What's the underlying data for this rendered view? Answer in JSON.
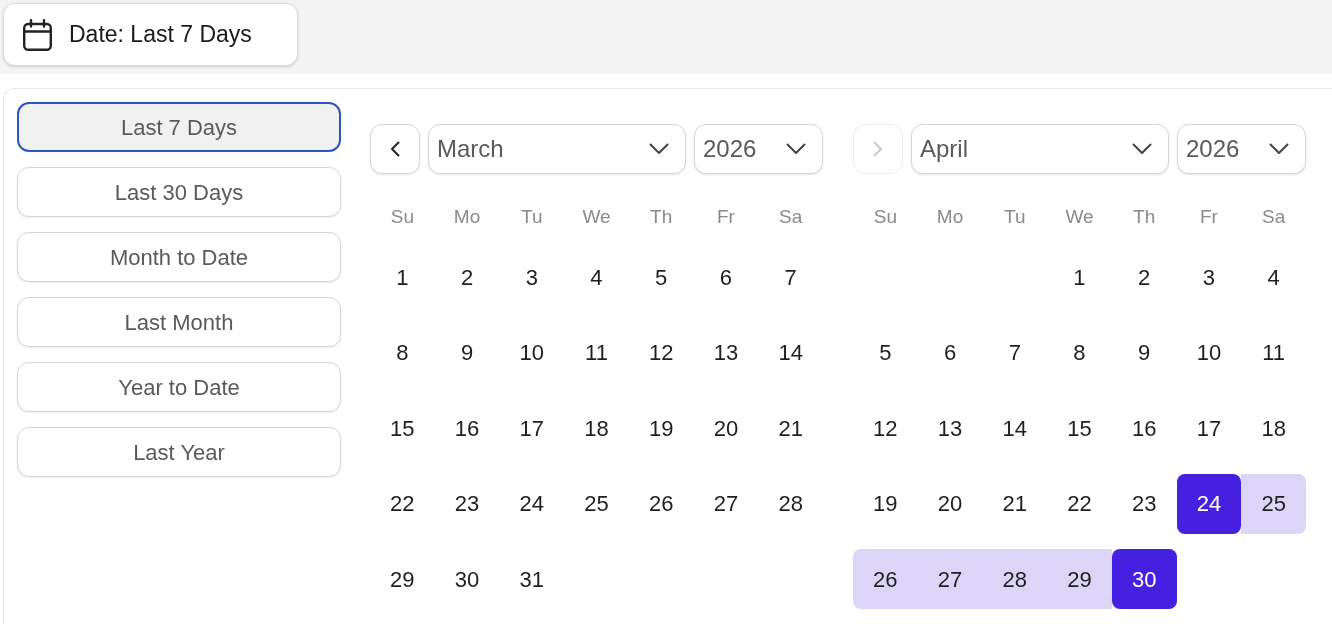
{
  "date_button": {
    "label": "Date: Last 7 Days"
  },
  "presets": [
    {
      "label": "Last 7 Days",
      "selected": true
    },
    {
      "label": "Last 30 Days",
      "selected": false
    },
    {
      "label": "Month to Date",
      "selected": false
    },
    {
      "label": "Last Month",
      "selected": false
    },
    {
      "label": "Year to Date",
      "selected": false
    },
    {
      "label": "Last Year",
      "selected": false
    }
  ],
  "calendars": [
    {
      "nav_button": {
        "kind": "prev",
        "disabled": false
      },
      "month": "March",
      "year": "2026",
      "weekdays": [
        "Su",
        "Mo",
        "Tu",
        "We",
        "Th",
        "Fr",
        "Sa"
      ],
      "weeks": [
        [
          {
            "kind": "day",
            "day": "1",
            "selected": false,
            "in_range": false
          },
          {
            "kind": "day",
            "day": "2",
            "selected": false,
            "in_range": false
          },
          {
            "kind": "day",
            "day": "3",
            "selected": false,
            "in_range": false
          },
          {
            "kind": "day",
            "day": "4",
            "selected": false,
            "in_range": false
          },
          {
            "kind": "day",
            "day": "5",
            "selected": false,
            "in_range": false
          },
          {
            "kind": "day",
            "day": "6",
            "selected": false,
            "in_range": false
          },
          {
            "kind": "day",
            "day": "7",
            "selected": false,
            "in_range": false
          }
        ],
        [
          {
            "kind": "day",
            "day": "8",
            "selected": false,
            "in_range": false
          },
          {
            "kind": "day",
            "day": "9",
            "selected": false,
            "in_range": false
          },
          {
            "kind": "day",
            "day": "10",
            "selected": false,
            "in_range": false
          },
          {
            "kind": "day",
            "day": "11",
            "selected": false,
            "in_range": false
          },
          {
            "kind": "day",
            "day": "12",
            "selected": false,
            "in_range": false
          },
          {
            "kind": "day",
            "day": "13",
            "selected": false,
            "in_range": false
          },
          {
            "kind": "day",
            "day": "14",
            "selected": false,
            "in_range": false
          }
        ],
        [
          {
            "kind": "day",
            "day": "15",
            "selected": false,
            "in_range": false
          },
          {
            "kind": "day",
            "day": "16",
            "selected": false,
            "in_range": false
          },
          {
            "kind": "day",
            "day": "17",
            "selected": false,
            "in_range": false
          },
          {
            "kind": "day",
            "day": "18",
            "selected": false,
            "in_range": false
          },
          {
            "kind": "day",
            "day": "19",
            "selected": false,
            "in_range": false
          },
          {
            "kind": "day",
            "day": "20",
            "selected": false,
            "in_range": false
          },
          {
            "kind": "day",
            "day": "21",
            "selected": false,
            "in_range": false
          }
        ],
        [
          {
            "kind": "day",
            "day": "22",
            "selected": false,
            "in_range": false
          },
          {
            "kind": "day",
            "day": "23",
            "selected": false,
            "in_range": false
          },
          {
            "kind": "day",
            "day": "24",
            "selected": false,
            "in_range": false
          },
          {
            "kind": "day",
            "day": "25",
            "selected": false,
            "in_range": false
          },
          {
            "kind": "day",
            "day": "26",
            "selected": false,
            "in_range": false
          },
          {
            "kind": "day",
            "day": "27",
            "selected": false,
            "in_range": false
          },
          {
            "kind": "day",
            "day": "28",
            "selected": false,
            "in_range": false
          }
        ],
        [
          {
            "kind": "day",
            "day": "29",
            "selected": false,
            "in_range": false
          },
          {
            "kind": "day",
            "day": "30",
            "selected": false,
            "in_range": false
          },
          {
            "kind": "day",
            "day": "31",
            "selected": false,
            "in_range": false
          }
        ]
      ]
    },
    {
      "nav_button": {
        "kind": "next",
        "disabled": true
      },
      "month": "April",
      "year": "2026",
      "weekdays": [
        "Su",
        "Mo",
        "Tu",
        "We",
        "Th",
        "Fr",
        "Sa"
      ],
      "weeks": [
        [
          {
            "kind": "blank"
          },
          {
            "kind": "blank"
          },
          {
            "kind": "blank"
          },
          {
            "kind": "day",
            "day": "1",
            "selected": false,
            "in_range": false
          },
          {
            "kind": "day",
            "day": "2",
            "selected": false,
            "in_range": false
          },
          {
            "kind": "day",
            "day": "3",
            "selected": false,
            "in_range": false
          },
          {
            "kind": "day",
            "day": "4",
            "selected": false,
            "in_range": false
          }
        ],
        [
          {
            "kind": "day",
            "day": "5",
            "selected": false,
            "in_range": false
          },
          {
            "kind": "day",
            "day": "6",
            "selected": false,
            "in_range": false
          },
          {
            "kind": "day",
            "day": "7",
            "selected": false,
            "in_range": false
          },
          {
            "kind": "day",
            "day": "8",
            "selected": false,
            "in_range": false
          },
          {
            "kind": "day",
            "day": "9",
            "selected": false,
            "in_range": false
          },
          {
            "kind": "day",
            "day": "10",
            "selected": false,
            "in_range": false
          },
          {
            "kind": "day",
            "day": "11",
            "selected": false,
            "in_range": false
          }
        ],
        [
          {
            "kind": "day",
            "day": "12",
            "selected": false,
            "in_range": false
          },
          {
            "kind": "day",
            "day": "13",
            "selected": false,
            "in_range": false
          },
          {
            "kind": "day",
            "day": "14",
            "selected": false,
            "in_range": false
          },
          {
            "kind": "day",
            "day": "15",
            "selected": false,
            "in_range": false
          },
          {
            "kind": "day",
            "day": "16",
            "selected": false,
            "in_range": false
          },
          {
            "kind": "day",
            "day": "17",
            "selected": false,
            "in_range": false
          },
          {
            "kind": "day",
            "day": "18",
            "selected": false,
            "in_range": false
          }
        ],
        [
          {
            "kind": "day",
            "day": "19",
            "selected": false,
            "in_range": false
          },
          {
            "kind": "day",
            "day": "20",
            "selected": false,
            "in_range": false
          },
          {
            "kind": "day",
            "day": "21",
            "selected": false,
            "in_range": false
          },
          {
            "kind": "day",
            "day": "22",
            "selected": false,
            "in_range": false
          },
          {
            "kind": "day",
            "day": "23",
            "selected": false,
            "in_range": false
          },
          {
            "kind": "day",
            "day": "24",
            "selected": true,
            "in_range": false
          },
          {
            "kind": "day",
            "day": "25",
            "selected": false,
            "in_range": true
          }
        ],
        [
          {
            "kind": "day",
            "day": "26",
            "selected": false,
            "in_range": true
          },
          {
            "kind": "day",
            "day": "27",
            "selected": false,
            "in_range": true
          },
          {
            "kind": "day",
            "day": "28",
            "selected": false,
            "in_range": true
          },
          {
            "kind": "day",
            "day": "29",
            "selected": false,
            "in_range": true
          },
          {
            "kind": "day",
            "day": "30",
            "selected": true,
            "in_range": false
          }
        ]
      ]
    }
  ]
}
